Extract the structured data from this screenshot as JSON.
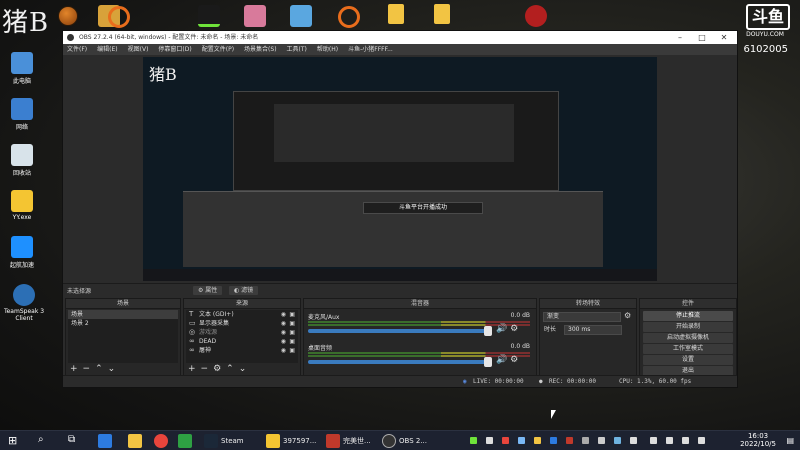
{
  "watermark": {
    "text": "猪B",
    "room": "6102005",
    "site": "DOUYU.COM",
    "logo": "斗鱼"
  },
  "desktop_icons": [
    {
      "label": "此电脑",
      "color": "#4a90d9"
    },
    {
      "label": "网络",
      "color": "#3b7fd0"
    },
    {
      "label": "回收站",
      "color": "#d8e3ea"
    },
    {
      "label": "YY.exe",
      "color": "#f4c532"
    },
    {
      "label": "起航加速",
      "color": "#1e90ff"
    },
    {
      "label": "TeamSpeak 3 Client",
      "color": "#2c6fb5"
    }
  ],
  "obs": {
    "title": "OBS 27.2.4 (64-bit, windows) - 配置文件: 未命名 - 场景: 未命名",
    "menu": [
      "文件(F)",
      "编辑(E)",
      "视图(V)",
      "停靠窗口(D)",
      "配置文件(P)",
      "场景集合(S)",
      "工具(T)",
      "帮助(H)",
      "斗鱼-小猪FFFF..."
    ],
    "preview_toast": "斗鱼平台开播成功",
    "no_source": "未选择源",
    "properties_button": "属性",
    "filters_button": "滤镜",
    "docks": {
      "scenes": {
        "title": "场景",
        "items": [
          "场景",
          "场景 2"
        ]
      },
      "sources": {
        "title": "来源",
        "items": [
          {
            "icon": "T",
            "label": "文本 (GDI+)"
          },
          {
            "icon": "▭",
            "label": "显示器采集"
          },
          {
            "icon": "◎",
            "label": "游戏源"
          },
          {
            "icon": "∞",
            "label": "DEAD"
          },
          {
            "icon": "∞",
            "label": "屠神"
          }
        ]
      },
      "mixer": {
        "title": "混音器",
        "channels": [
          {
            "name": "麦克风/Aux",
            "db": "0.0 dB"
          },
          {
            "name": "桌面音频",
            "db": "0.0 dB"
          }
        ]
      },
      "transitions": {
        "title": "转场特效",
        "type": "渐变",
        "duration_label": "时长",
        "duration": "300 ms"
      },
      "controls": {
        "title": "控件",
        "buttons": [
          "停止推流",
          "开始录制",
          "启动虚拟摄像机",
          "工作室模式",
          "设置",
          "退出"
        ]
      }
    },
    "status": {
      "live": "LIVE: 00:00:00",
      "rec": "REC: 00:00:00",
      "cpu": "CPU: 1.3%, 60.00 fps"
    }
  },
  "taskbar": {
    "apps": [
      {
        "label": "Steam",
        "color": "#1b2838"
      },
      {
        "label": "397597...",
        "color": "#f4c532"
      },
      {
        "label": "完美世...",
        "color": "#c0392b"
      },
      {
        "label": "OBS 2...",
        "color": "#333333"
      }
    ],
    "time": "16:03",
    "date": "2022/10/5"
  }
}
